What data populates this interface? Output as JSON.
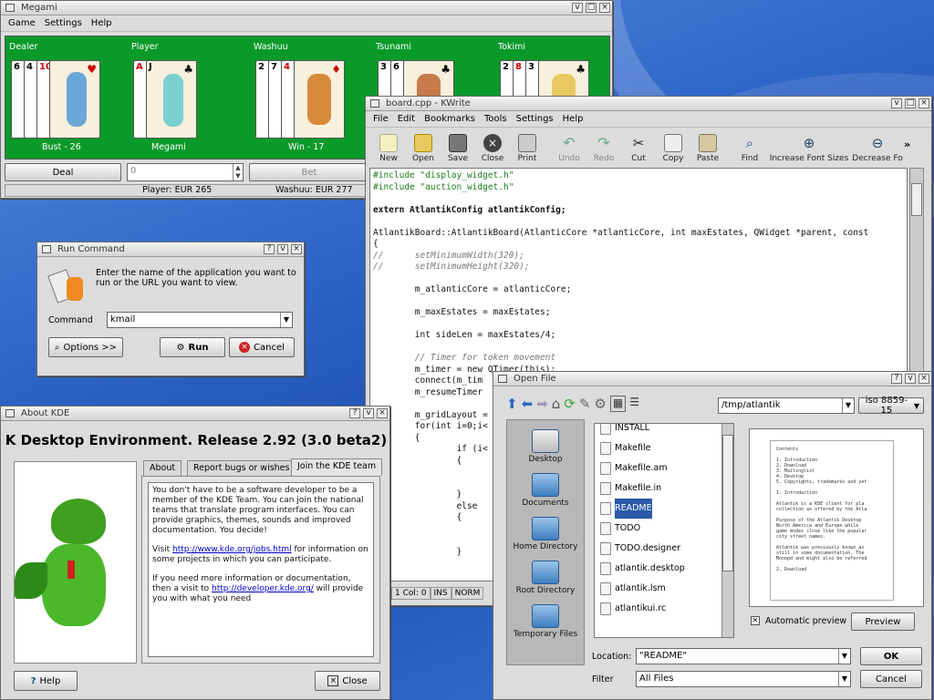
{
  "megami": {
    "title": "Megami",
    "menu": [
      "Game",
      "Settings",
      "Help"
    ],
    "players": [
      {
        "name": "Dealer",
        "cards": [
          "6",
          "4",
          "10"
        ],
        "status": "Bust - 26"
      },
      {
        "name": "Player",
        "cards": [
          "A",
          "J"
        ],
        "status": "Megami"
      },
      {
        "name": "Washuu",
        "cards": [
          "2",
          "7",
          "4"
        ],
        "status": "Win - 17"
      },
      {
        "name": "Tsunami",
        "cards": [
          "3",
          "6"
        ],
        "status": ""
      },
      {
        "name": "Tokimi",
        "cards": [
          "2",
          "8",
          "3"
        ],
        "status": ""
      }
    ],
    "deal_label": "Deal",
    "bet_value": "0",
    "bet_label": "Bet",
    "status_player": "Player: EUR 265",
    "status_washuu": "Washuu: EUR 277",
    "felt_color": "#0a9a2a"
  },
  "kwrite": {
    "title": "board.cpp - KWrite",
    "menu": [
      "File",
      "Edit",
      "Bookmarks",
      "Tools",
      "Settings",
      "Help"
    ],
    "toolbar": [
      {
        "label": "New",
        "icon": "new-file-icon"
      },
      {
        "label": "Open",
        "icon": "open-folder-icon"
      },
      {
        "label": "Save",
        "icon": "save-icon"
      },
      {
        "label": "Close",
        "icon": "close-file-icon"
      },
      {
        "label": "Print",
        "icon": "print-icon"
      },
      {
        "label": "Undo",
        "icon": "undo-icon"
      },
      {
        "label": "Redo",
        "icon": "redo-icon"
      },
      {
        "label": "Cut",
        "icon": "cut-icon"
      },
      {
        "label": "Copy",
        "icon": "copy-icon"
      },
      {
        "label": "Paste",
        "icon": "paste-icon"
      },
      {
        "label": "Find",
        "icon": "find-icon"
      },
      {
        "label": "Increase Font Sizes",
        "icon": "zoom-in-icon"
      },
      {
        "label": "Decrease Fo",
        "icon": "zoom-out-icon"
      }
    ],
    "code_lines": [
      "#include \"display_widget.h\"",
      "#include \"auction_widget.h\"",
      "",
      "extern AtlantikConfig atlantikConfig;",
      "",
      "AtlantikBoard::AtlantikBoard(AtlanticCore *atlanticCore, int maxEstates, QWidget *parent, const",
      "{",
      "//      setMinimumWidth(320);",
      "//      setMinimumHeight(320);",
      "",
      "        m_atlanticCore = atlanticCore;",
      "",
      "        m_maxEstates = maxEstates;",
      "",
      "        int sideLen = maxEstates/4;",
      "",
      "        // Timer for token movement",
      "        m_timer = new QTimer(this);",
      "        connect(m_tim",
      "        m_resumeTimer",
      "",
      "        m_gridLayout =",
      "        for(int i=0;i<",
      "        {",
      "                if (i<",
      "                {",
      "",
      "",
      "                }",
      "                else",
      "                {",
      "",
      "",
      "                }"
    ],
    "status": [
      "1 Col: 0",
      "INS",
      "NORM"
    ]
  },
  "run": {
    "title": "Run Command",
    "description": "Enter the name of the application you want to run or the URL you want to view.",
    "command_label": "Command",
    "command_value": "kmail",
    "options_label": "Options >>",
    "run_label": "Run",
    "cancel_label": "Cancel"
  },
  "about": {
    "title": "About KDE",
    "heading": "K Desktop Environment. Release 2.92 (3.0 beta2)",
    "tabs": [
      "About",
      "Report bugs or wishes",
      "Join the KDE team"
    ],
    "p1": "You don't have to be a software developer to be a member of the KDE Team. You can join the national teams that translate program interfaces. You can provide graphics, themes, sounds and improved documentation. You decide!",
    "p2_pre": "Visit ",
    "p2_link": "http://www.kde.org/jobs.html",
    "p2_post": " for information on some projects in which you can participate.",
    "p3_pre": "If you need more information or documentation, then a visit to ",
    "p3_link": "http://developer.kde.org/",
    "p3_post": " will provide you with what you need",
    "help_label": "Help",
    "close_label": "Close"
  },
  "openfile": {
    "title": "Open File",
    "path": "/tmp/atlantik",
    "encoding": "iso 8859-15",
    "places": [
      "Desktop",
      "Documents",
      "Home Directory",
      "Root Directory",
      "Temporary Files"
    ],
    "files": [
      "INSTALL",
      "Makefile",
      "Makefile.am",
      "Makefile.in",
      "README",
      "TODO",
      "TODO.designer",
      "atlantik.desktop",
      "atlantik.lsm",
      "atlantikui.rc"
    ],
    "selected": "README",
    "preview_lines": [
      "Contents",
      "",
      "1. Introduction",
      "2. Download",
      "3. Mailinglist",
      "4. Desktop",
      "5. Copyrights, trademarks and yet",
      "",
      "1. Introduction",
      "",
      "Atlantik is a KDE client for pla",
      "collection as offered by the Atla",
      "",
      "Purpose of the Atlantik Desktop",
      "North America and Europe while",
      "game modes close like the popular",
      "city street names.",
      "",
      "Atlantik was previously known as",
      "still in some documentation. The",
      "Monopd and might also be referred",
      "",
      "2. Download"
    ],
    "auto_preview_label": "Automatic preview",
    "preview_button": "Preview",
    "location_label": "Location:",
    "location_value": "\"README\"",
    "filter_label": "Filter",
    "filter_value": "All Files",
    "ok_label": "OK",
    "cancel_label": "Cancel"
  }
}
